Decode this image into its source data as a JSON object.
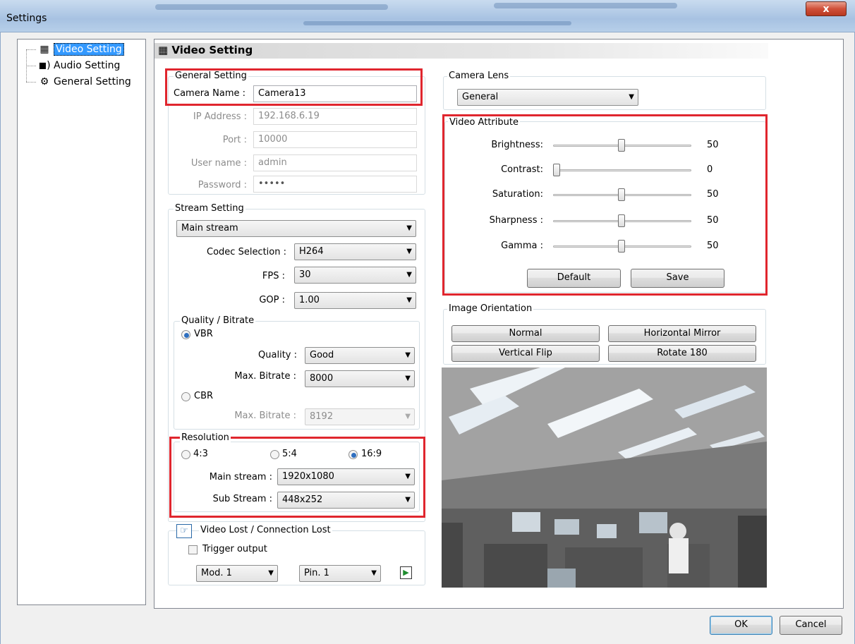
{
  "window": {
    "title": "Settings",
    "close_glyph": "x"
  },
  "tree": {
    "items": [
      {
        "label": "Video Setting",
        "icon": "film-icon",
        "selected": true
      },
      {
        "label": "Audio Setting",
        "icon": "speaker-icon",
        "selected": false
      },
      {
        "label": "General Setting",
        "icon": "gear-icon",
        "selected": false
      }
    ]
  },
  "header": {
    "title": "Video Setting"
  },
  "general": {
    "group_label": "General Setting",
    "camera_name_label": "Camera Name :",
    "camera_name": "Camera13",
    "ip_label": "IP Address :",
    "ip": "192.168.6.19",
    "port_label": "Port :",
    "port": "10000",
    "user_label": "User name :",
    "user": "admin",
    "password_label": "Password :",
    "password": "•••••"
  },
  "stream": {
    "group_label": "Stream Setting",
    "stream_select": "Main stream",
    "codec_label": "Codec Selection :",
    "codec": "H264",
    "fps_label": "FPS :",
    "fps": "30",
    "gop_label": "GOP :",
    "gop": "1.00"
  },
  "quality": {
    "group_label": "Quality / Bitrate",
    "vbr_label": "VBR",
    "vbr_selected": true,
    "quality_label": "Quality :",
    "quality": "Good",
    "vbr_max_label": "Max. Bitrate :",
    "vbr_max": "8000",
    "cbr_label": "CBR",
    "cbr_max_label": "Max. Bitrate :",
    "cbr_max": "8192"
  },
  "resolution": {
    "group_label": "Resolution",
    "ratio_43": "4:3",
    "ratio_54": "5:4",
    "ratio_169": "16:9",
    "selected_ratio": "16:9",
    "main_label": "Main stream :",
    "main": "1920x1080",
    "sub_label": "Sub Stream :",
    "sub": "448x252"
  },
  "lost": {
    "group_label": "Video Lost / Connection Lost",
    "trigger_label": "Trigger output",
    "trigger_checked": false,
    "mod": "Mod. 1",
    "pin": "Pin. 1"
  },
  "lens": {
    "group_label": "Camera Lens",
    "value": "General"
  },
  "attributes": {
    "group_label": "Video Attribute",
    "items": [
      {
        "label": "Brightness:",
        "value": "50",
        "level": 0.5
      },
      {
        "label": "Contrast:",
        "value": "0",
        "level": 0
      },
      {
        "label": "Saturation:",
        "value": "50",
        "level": 0.5
      },
      {
        "label": "Sharpness :",
        "value": "50",
        "level": 0.5
      },
      {
        "label": "Gamma :",
        "value": "50",
        "level": 0.5
      }
    ],
    "default_btn": "Default",
    "save_btn": "Save"
  },
  "orientation": {
    "group_label": "Image Orientation",
    "normal": "Normal",
    "hmirror": "Horizontal Mirror",
    "vflip": "Vertical Flip",
    "rotate": "Rotate 180"
  },
  "footer": {
    "ok": "OK",
    "cancel": "Cancel"
  }
}
